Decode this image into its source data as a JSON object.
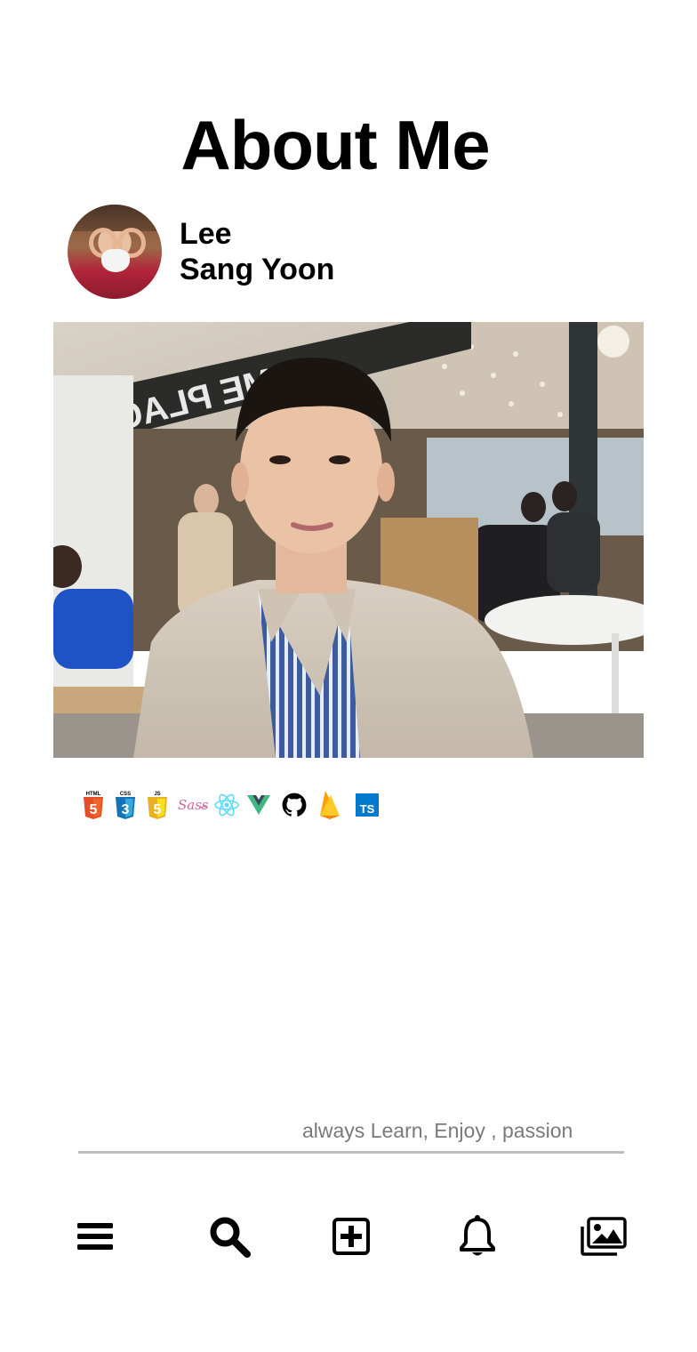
{
  "page": {
    "title": "About Me"
  },
  "profile": {
    "first_name": "Lee",
    "last_name": "Sang Yoon"
  },
  "photo": {
    "sign_text": "OME PLACE"
  },
  "skills": [
    {
      "name": "HTML5",
      "icon": "html5-icon",
      "label": "HTML",
      "glyph": "5",
      "color": "#e44d26"
    },
    {
      "name": "CSS3",
      "icon": "css3-icon",
      "label": "CSS",
      "glyph": "3",
      "color": "#1572b6"
    },
    {
      "name": "JavaScript",
      "icon": "javascript-icon",
      "label": "JS",
      "glyph": "5",
      "color": "#f0db4f"
    },
    {
      "name": "Sass",
      "icon": "sass-icon",
      "glyph": "Sass",
      "color": "#cd6799"
    },
    {
      "name": "React",
      "icon": "react-icon",
      "color": "#61dafb"
    },
    {
      "name": "Vue",
      "icon": "vue-icon",
      "color": "#41b883"
    },
    {
      "name": "GitHub",
      "icon": "github-icon",
      "color": "#000000"
    },
    {
      "name": "Firebase",
      "icon": "firebase-icon",
      "color": "#ffca28"
    },
    {
      "name": "TypeScript",
      "icon": "typescript-icon",
      "glyph": "TS",
      "color": "#007acc"
    }
  ],
  "motto": "always Learn, Enjoy , passion",
  "tabbar": [
    {
      "name": "menu",
      "icon": "hamburger-menu-icon"
    },
    {
      "name": "search",
      "icon": "search-icon"
    },
    {
      "name": "add",
      "icon": "add-square-icon"
    },
    {
      "name": "notifications",
      "icon": "bell-icon"
    },
    {
      "name": "gallery",
      "icon": "images-icon"
    }
  ]
}
